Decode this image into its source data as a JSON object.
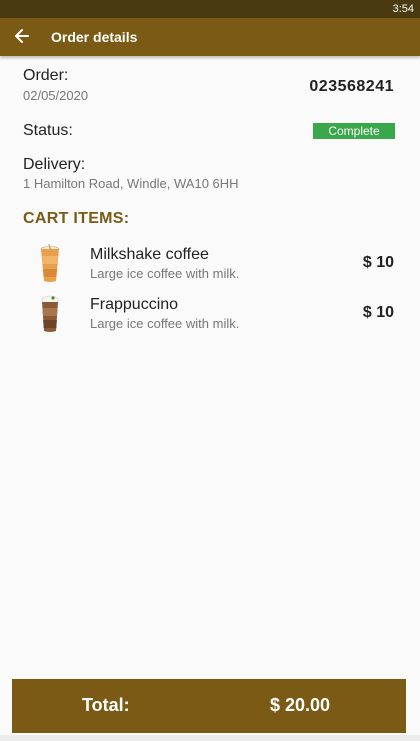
{
  "status_bar": {
    "time": "3:54"
  },
  "app_bar": {
    "title": "Order details",
    "back_icon": "arrow-left-icon"
  },
  "order": {
    "label": "Order:",
    "date": "02/05/2020",
    "number": "023568241",
    "status_label": "Status:",
    "status_value": "Complete",
    "status_color": "#3aa84a",
    "delivery_label": "Delivery:",
    "delivery_address": "1 Hamilton Road, Windle, WA10 6HH"
  },
  "cart": {
    "heading": "CART ITEMS:",
    "items": [
      {
        "name": "Milkshake coffee",
        "description": "Large ice coffee with milk.",
        "price": "$ 10",
        "icon": "iced-coffee-cup-icon"
      },
      {
        "name": "Frappuccino",
        "description": "Large ice coffee with milk.",
        "price": "$ 10",
        "icon": "frappuccino-cup-icon"
      }
    ]
  },
  "total": {
    "label": "Total:",
    "value": "$ 20.00"
  },
  "colors": {
    "brand": "#7a5a14",
    "status_bar": "#4a3a12",
    "success": "#3aa84a"
  }
}
